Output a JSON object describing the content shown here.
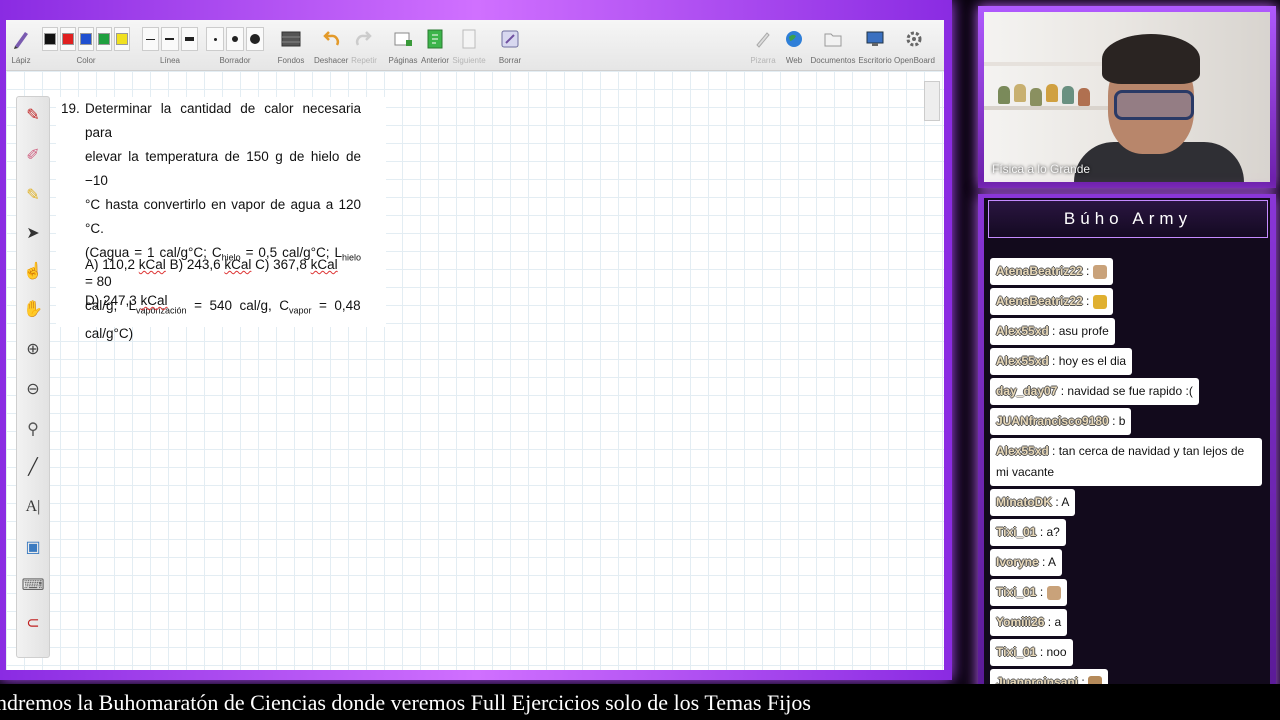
{
  "toolbar": {
    "tools": [
      {
        "label": "Lápiz",
        "icon": "pencil-icon"
      },
      {
        "label": "Color",
        "icon": "color-swatches"
      },
      {
        "label": "Línea",
        "icon": "line-width-icon"
      },
      {
        "label": "Borrador",
        "icon": "eraser-size-icon"
      },
      {
        "label": "Fondos",
        "icon": "background-icon"
      },
      {
        "label": "Deshacer",
        "icon": "undo-icon"
      },
      {
        "label": "Repetir",
        "icon": "redo-icon"
      },
      {
        "label": "Páginas",
        "icon": "pages-icon"
      },
      {
        "label": "Anterior",
        "icon": "previous-icon"
      },
      {
        "label": "Siguiente",
        "icon": "next-icon"
      },
      {
        "label": "Borrar",
        "icon": "clear-icon"
      },
      {
        "label": "Pizarra",
        "icon": "board-icon"
      },
      {
        "label": "Web",
        "icon": "globe-icon"
      },
      {
        "label": "Documentos",
        "icon": "folder-icon"
      },
      {
        "label": "Escritorio",
        "icon": "desktop-icon"
      },
      {
        "label": "OpenBoard",
        "icon": "gear-icon"
      }
    ],
    "colors": [
      "#111111",
      "#e02020",
      "#2050d0",
      "#20a040",
      "#f0e020"
    ]
  },
  "problem": {
    "number": "19.",
    "line1": "Determinar la cantidad de calor necesaria para",
    "line2": "elevar la temperatura de 150 g de hielo de −10",
    "line3": "°C hasta convertirlo en vapor de agua a 120 °C.",
    "line4a": "(Cagua = 1 cal/g°C; C",
    "sub_hielo": "hielo",
    "line4b": " = 0,5 cal/g°C; L",
    "sub_hielo2": "hielo",
    "line4c": " = 80",
    "line5a": "cal/g,   L",
    "sub_vap": "vaporización",
    "line5b": "  =  540  cal/g,  C",
    "sub_vapor": "vapor",
    "line5c": "  =  0,48",
    "line6": "cal/g°C)",
    "options_1": "A) 110,2 kCal B) 243,6 kCal C) 367,8 kCal",
    "options_2": "D) 247,3 kCal"
  },
  "webcam": {
    "label": "Física a lo Grande"
  },
  "chat": {
    "title": "Búho Army",
    "messages": [
      {
        "user": "AtenaBeatriz22",
        "text": "",
        "emoji": "cat",
        "user_color": "#6ee07a"
      },
      {
        "user": "AtenaBeatriz22",
        "text": "",
        "emoji": "cheer",
        "user_color": "#6ee07a"
      },
      {
        "user": "Alex55xd",
        "text": "asu profe",
        "user_color": "#e8c890"
      },
      {
        "user": "Alex55xd",
        "text": "hoy es el dia",
        "user_color": "#e8c890"
      },
      {
        "user": "day_day07",
        "text": "navidad se fue rapido :(",
        "user_color": "#d8a0a8"
      },
      {
        "user": "JUANfrancisco9180",
        "text": "b",
        "user_color": "#a8c0e8"
      },
      {
        "user": "Alex55xd",
        "text": "tan cerca de navidad y tan lejos de mi vacante",
        "user_color": "#e8c890"
      },
      {
        "user": "MinatoDK",
        "text": "A",
        "user_color": "#c080f0"
      },
      {
        "user": "Tixi_01",
        "text": "a?",
        "user_color": "#e8c890"
      },
      {
        "user": "Ivoryne",
        "text": "A",
        "user_color": "#e8a0b8"
      },
      {
        "user": "Tixi_01",
        "text": "",
        "emoji": "cat",
        "user_color": "#e8c890"
      },
      {
        "user": "Yomiii26",
        "text": "a",
        "user_color": "#60e0c8"
      },
      {
        "user": "Tixi_01",
        "text": "noo",
        "user_color": "#e8c890"
      },
      {
        "user": "Juanproinsani",
        "text": "",
        "emoji": "owl",
        "user_color": "#f0a0d0"
      }
    ]
  },
  "ticker": {
    "text": "ndremos la Buhomaratón de Ciencias donde veremos Full Ejercicios solo de los Temas Fijos"
  }
}
